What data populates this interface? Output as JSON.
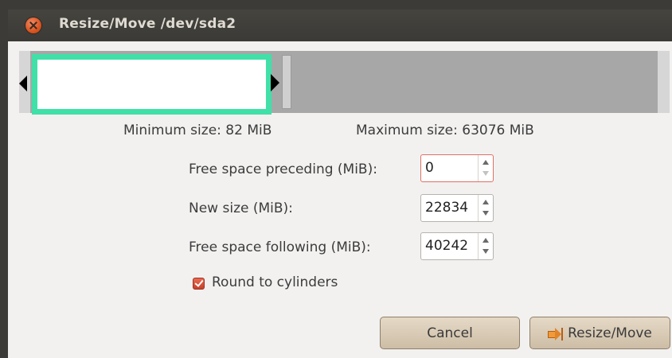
{
  "window": {
    "title": "Resize/Move /dev/sda2"
  },
  "graph": {
    "used_fraction": 0.362
  },
  "limits": {
    "min_label": "Minimum size: 82 MiB",
    "max_label": "Maximum size: 63076 MiB"
  },
  "fields": [
    {
      "label": "Free space preceding (MiB):",
      "value": "0"
    },
    {
      "label": "New size (MiB):",
      "value": "22834"
    },
    {
      "label": "Free space following (MiB):",
      "value": "40242"
    }
  ],
  "round_to_cylinders": {
    "label": "Round to cylinders",
    "checked": true
  },
  "buttons": {
    "cancel": "Cancel",
    "resize": "Resize/Move"
  },
  "colors": {
    "partition_border": "#40e0a8",
    "close_button": "#d9541f"
  }
}
